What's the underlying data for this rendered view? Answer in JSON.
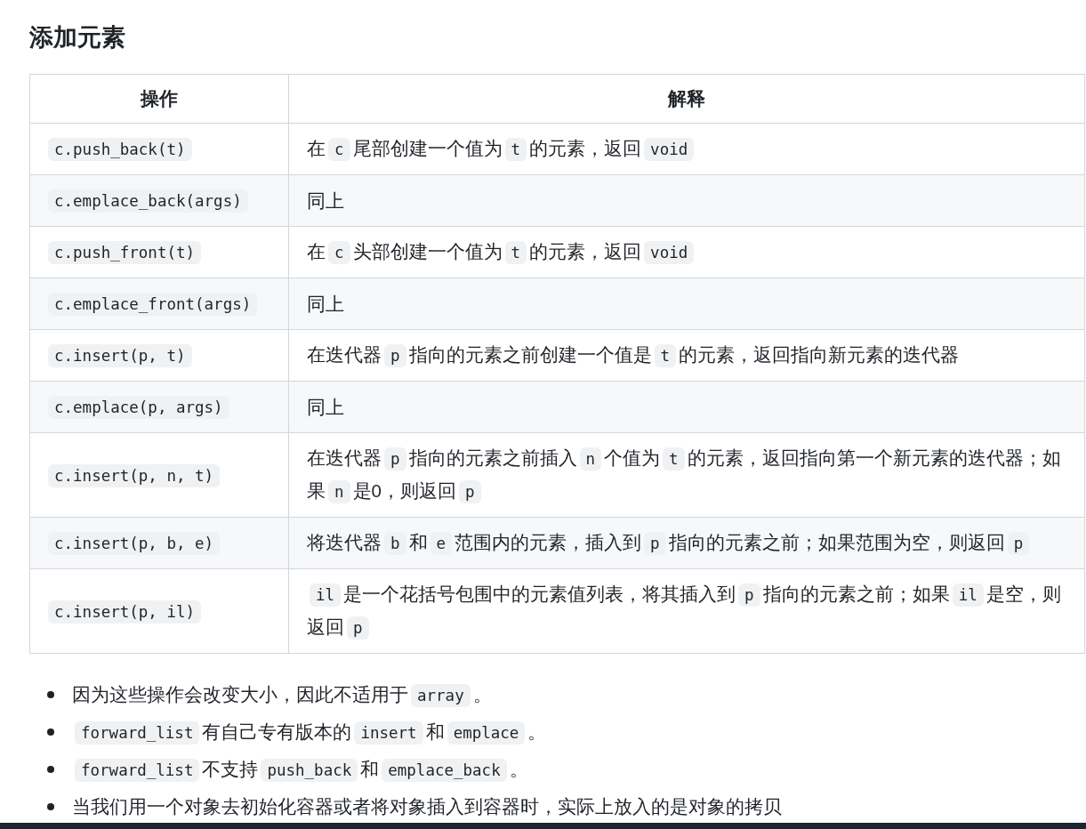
{
  "heading": "添加元素",
  "table": {
    "columns": [
      "操作",
      "解释"
    ],
    "rows": [
      {
        "operation": "c.push_back(t)",
        "explanation": [
          {
            "kind": "text",
            "text": "在"
          },
          {
            "kind": "code",
            "text": "c"
          },
          {
            "kind": "text",
            "text": "尾部创建一个值为"
          },
          {
            "kind": "code",
            "text": "t"
          },
          {
            "kind": "text",
            "text": "的元素，返回"
          },
          {
            "kind": "code",
            "text": "void"
          }
        ]
      },
      {
        "operation": "c.emplace_back(args)",
        "explanation": [
          {
            "kind": "text",
            "text": "同上"
          }
        ]
      },
      {
        "operation": "c.push_front(t)",
        "explanation": [
          {
            "kind": "text",
            "text": "在"
          },
          {
            "kind": "code",
            "text": "c"
          },
          {
            "kind": "text",
            "text": "头部创建一个值为"
          },
          {
            "kind": "code",
            "text": "t"
          },
          {
            "kind": "text",
            "text": "的元素，返回"
          },
          {
            "kind": "code",
            "text": "void"
          }
        ]
      },
      {
        "operation": "c.emplace_front(args)",
        "explanation": [
          {
            "kind": "text",
            "text": "同上"
          }
        ]
      },
      {
        "operation": "c.insert(p, t)",
        "explanation": [
          {
            "kind": "text",
            "text": "在迭代器"
          },
          {
            "kind": "code",
            "text": "p"
          },
          {
            "kind": "text",
            "text": "指向的元素之前创建一个值是"
          },
          {
            "kind": "code",
            "text": "t"
          },
          {
            "kind": "text",
            "text": "的元素，返回指向新元素的迭代器"
          }
        ]
      },
      {
        "operation": "c.emplace(p, args)",
        "explanation": [
          {
            "kind": "text",
            "text": "同上"
          }
        ]
      },
      {
        "operation": "c.insert(p, n, t)",
        "explanation": [
          {
            "kind": "text",
            "text": "在迭代器"
          },
          {
            "kind": "code",
            "text": "p"
          },
          {
            "kind": "text",
            "text": "指向的元素之前插入"
          },
          {
            "kind": "code",
            "text": "n"
          },
          {
            "kind": "text",
            "text": "个值为"
          },
          {
            "kind": "code",
            "text": "t"
          },
          {
            "kind": "text",
            "text": "的元素，返回指向第一个新元素的迭代器；如果"
          },
          {
            "kind": "code",
            "text": "n"
          },
          {
            "kind": "text",
            "text": "是0，则返回"
          },
          {
            "kind": "code",
            "text": "p"
          }
        ]
      },
      {
        "operation": "c.insert(p, b, e)",
        "explanation": [
          {
            "kind": "text",
            "text": "将迭代器"
          },
          {
            "kind": "code",
            "text": "b"
          },
          {
            "kind": "text",
            "text": "和"
          },
          {
            "kind": "code",
            "text": "e"
          },
          {
            "kind": "text",
            "text": "范围内的元素，插入到"
          },
          {
            "kind": "code",
            "text": "p"
          },
          {
            "kind": "text",
            "text": "指向的元素之前；如果范围为空，则返回"
          },
          {
            "kind": "code",
            "text": "p"
          }
        ]
      },
      {
        "operation": "c.insert(p, il)",
        "explanation": [
          {
            "kind": "code",
            "text": "il"
          },
          {
            "kind": "text",
            "text": "是一个花括号包围中的元素值列表，将其插入到"
          },
          {
            "kind": "code",
            "text": "p"
          },
          {
            "kind": "text",
            "text": "指向的元素之前；如果"
          },
          {
            "kind": "code",
            "text": "il"
          },
          {
            "kind": "text",
            "text": "是空，则返回"
          },
          {
            "kind": "code",
            "text": "p"
          }
        ]
      }
    ]
  },
  "notes": [
    [
      {
        "kind": "text",
        "text": "因为这些操作会改变大小，因此不适用于"
      },
      {
        "kind": "code",
        "text": "array"
      },
      {
        "kind": "text",
        "text": "。"
      }
    ],
    [
      {
        "kind": "code",
        "text": "forward_list"
      },
      {
        "kind": "text",
        "text": "有自己专有版本的"
      },
      {
        "kind": "code",
        "text": "insert"
      },
      {
        "kind": "text",
        "text": "和"
      },
      {
        "kind": "code",
        "text": "emplace"
      },
      {
        "kind": "text",
        "text": "。"
      }
    ],
    [
      {
        "kind": "code",
        "text": "forward_list"
      },
      {
        "kind": "text",
        "text": "不支持"
      },
      {
        "kind": "code",
        "text": "push_back"
      },
      {
        "kind": "text",
        "text": "和"
      },
      {
        "kind": "code",
        "text": "emplace_back"
      },
      {
        "kind": "text",
        "text": "。"
      }
    ],
    [
      {
        "kind": "text",
        "text": "当我们用一个对象去初始化容器或者将对象插入到容器时，实际上放入的是对象的拷贝"
      }
    ]
  ]
}
